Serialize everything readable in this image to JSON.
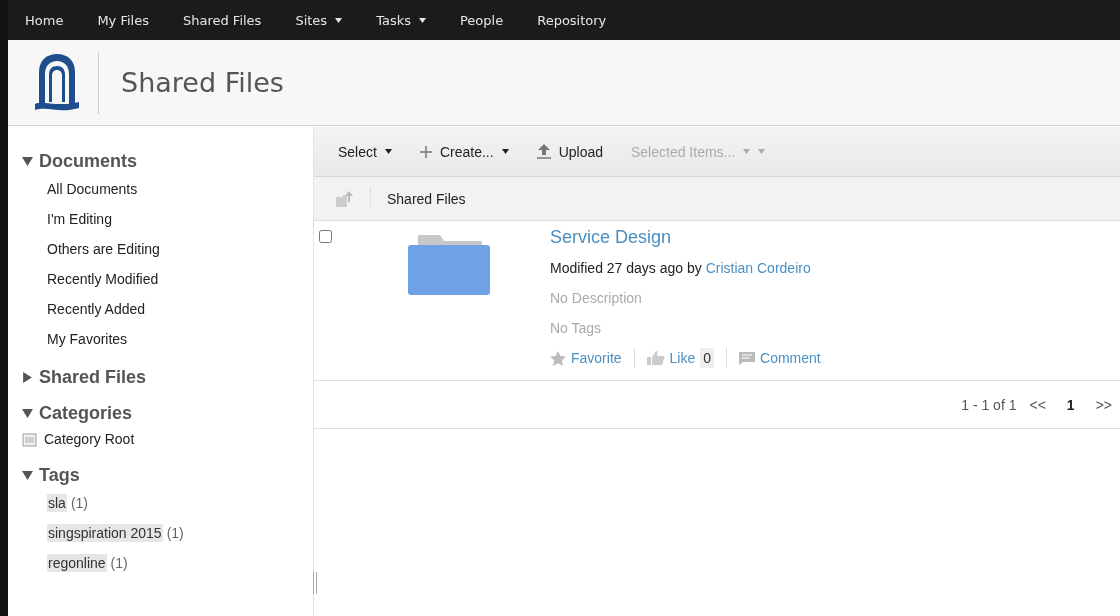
{
  "nav": [
    {
      "label": "Home",
      "has_menu": false
    },
    {
      "label": "My Files",
      "has_menu": false
    },
    {
      "label": "Shared Files",
      "has_menu": false
    },
    {
      "label": "Sites",
      "has_menu": true
    },
    {
      "label": "Tasks",
      "has_menu": true
    },
    {
      "label": "People",
      "has_menu": false
    },
    {
      "label": "Repository",
      "has_menu": false
    }
  ],
  "header": {
    "title": "Shared Files"
  },
  "sidebar": [
    {
      "title": "Documents",
      "expanded": true,
      "kind": "filters",
      "items": [
        {
          "label": "All Documents"
        },
        {
          "label": "I'm Editing"
        },
        {
          "label": "Others are Editing"
        },
        {
          "label": "Recently Modified"
        },
        {
          "label": "Recently Added"
        },
        {
          "label": "My Favorites"
        }
      ]
    },
    {
      "title": "Shared Files",
      "expanded": false,
      "kind": "filters"
    },
    {
      "title": "Categories",
      "expanded": true,
      "kind": "categories",
      "items": [
        {
          "label": "Category Root"
        }
      ]
    },
    {
      "title": "Tags",
      "expanded": true,
      "kind": "tags",
      "items": [
        {
          "label": "sla",
          "count": "(1)"
        },
        {
          "label": "singspiration 2015",
          "count": "(1)"
        },
        {
          "label": "regonline",
          "count": "(1)"
        }
      ]
    }
  ],
  "toolbar": [
    {
      "label": "Select",
      "kind": "menu",
      "disabled": false
    },
    {
      "label": "Create...",
      "kind": "create",
      "disabled": false
    },
    {
      "label": "Upload",
      "kind": "upload",
      "disabled": false
    },
    {
      "label": "Selected Items...",
      "kind": "menu",
      "disabled": true
    }
  ],
  "breadcrumb": "Shared Files",
  "documents": [
    {
      "name": "Service Design",
      "checked": false,
      "modified": "Modified 27 days ago by",
      "author": "Cristian Cordeiro",
      "description": "No Description",
      "tags": "No Tags",
      "favorite": "Favorite",
      "like": "Like",
      "like_count": "0",
      "comment": "Comment"
    }
  ],
  "pagination": {
    "range": "1 - 1 of 1",
    "prev": "<<",
    "pages": [
      {
        "label": "1",
        "selected": true
      }
    ],
    "next": ">>"
  }
}
